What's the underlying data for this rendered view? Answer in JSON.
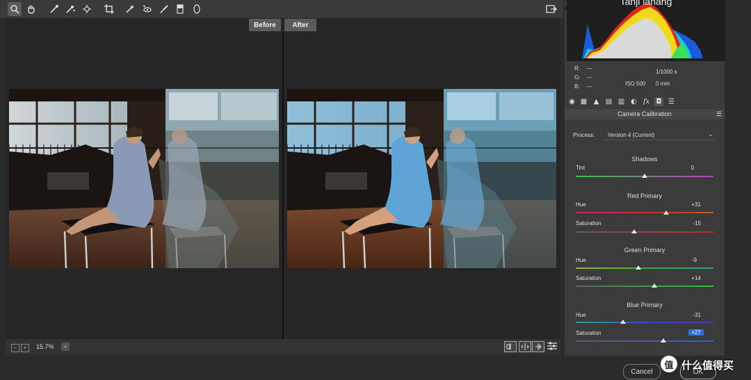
{
  "toolbar": {
    "tools": [
      {
        "name": "zoom-tool",
        "glyph": "🔍"
      },
      {
        "name": "hand-tool",
        "glyph": "✋"
      },
      {
        "name": "white-balance-tool",
        "glyph": "✎"
      },
      {
        "name": "color-sampler-tool",
        "glyph": "✦"
      },
      {
        "name": "targeted-adjustment-tool",
        "glyph": "⊕"
      },
      {
        "name": "crop-tool",
        "glyph": "⌗"
      },
      {
        "name": "straighten-tool",
        "glyph": "⟋"
      },
      {
        "name": "spot-removal-tool",
        "glyph": "◉"
      },
      {
        "name": "red-eye-tool",
        "glyph": "⊙"
      },
      {
        "name": "adjustment-brush-tool",
        "glyph": "✐"
      },
      {
        "name": "graduated-filter-tool",
        "glyph": "▤"
      },
      {
        "name": "radial-filter-tool",
        "glyph": "◯"
      }
    ],
    "open_in_glyph": "⇱"
  },
  "preview": {
    "before_label": "Before",
    "after_label": "After"
  },
  "status": {
    "zoom": "15.7%",
    "zoom_out": "−",
    "zoom_in": "+",
    "zoom_menu": "⌄"
  },
  "histogram": {
    "title": "Tanji lanang",
    "r_label": "R:",
    "r_value": "---",
    "g_label": "G:",
    "g_value": "---",
    "b_label": "B:",
    "b_value": "---",
    "shutter": "1/1000 s",
    "iso": "ISO 500",
    "focal": "0 mm"
  },
  "panel": {
    "section_title": "Camera Calibration",
    "process_label": "Process:",
    "process_value": "Version 4 (Current)",
    "shadows": {
      "title": "Shadows",
      "tint_label": "Tint",
      "tint_value": "0",
      "tint_pos": 0.5
    },
    "red": {
      "title": "Red Primary",
      "hue_label": "Hue",
      "hue_value": "+31",
      "hue_pos": 0.655,
      "sat_label": "Saturation",
      "sat_value": "-15",
      "sat_pos": 0.425
    },
    "green": {
      "title": "Green Primary",
      "hue_label": "Hue",
      "hue_value": "-9",
      "hue_pos": 0.455,
      "sat_label": "Saturation",
      "sat_value": "+14",
      "sat_pos": 0.57
    },
    "blue": {
      "title": "Blue Primary",
      "hue_label": "Hue",
      "hue_value": "-31",
      "hue_pos": 0.345,
      "sat_label": "Saturation",
      "sat_value": "+27",
      "sat_pos": 0.635
    }
  },
  "footer": {
    "cancel": "Cancel",
    "ok": "OK"
  },
  "watermark": {
    "text": "什么值得买",
    "logo": "值"
  }
}
